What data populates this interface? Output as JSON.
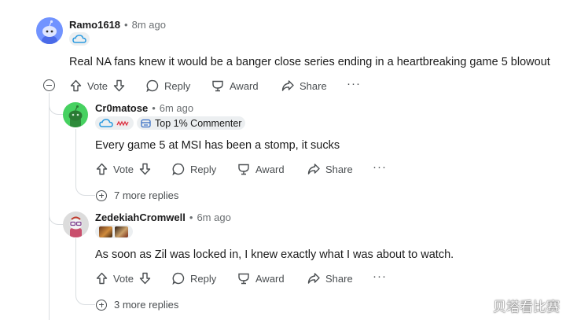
{
  "comments": [
    {
      "username": "Ramo1618",
      "time": "8m ago",
      "text": "Real NA fans knew it would be a banger close series ending in a heartbreaking game 5 blowout",
      "avatar_color": "#7193ff"
    },
    {
      "username": "Cr0matose",
      "time": "6m ago",
      "top_commenter": "Top 1% Commenter",
      "text": "Every game 5 at MSI has been a stomp, it sucks",
      "more_replies": "7 more replies",
      "avatar_color": "#46d160"
    },
    {
      "username": "ZedekiahCromwell",
      "time": "6m ago",
      "text": "As soon as Zil was locked in, I knew exactly what I was about to watch.",
      "more_replies": "3 more replies"
    }
  ],
  "actions": {
    "vote": "Vote",
    "reply": "Reply",
    "award": "Award",
    "share": "Share",
    "more": "···"
  },
  "separator": "•",
  "watermark": "贝塔看比赛"
}
